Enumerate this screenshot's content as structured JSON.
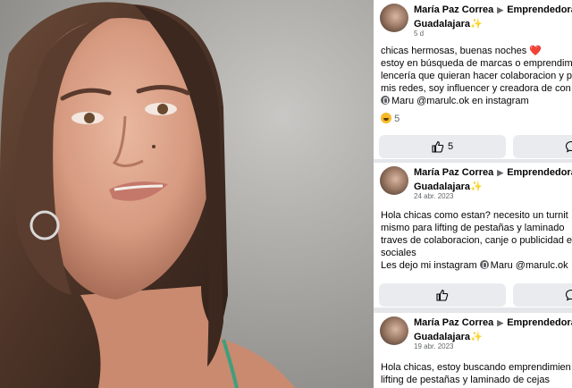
{
  "posts": [
    {
      "author": "María Paz Correa",
      "group_part1": "Emprendedora",
      "group_part2": "Guadalajara",
      "sparkle": "✨",
      "time": "5 d",
      "body": [
        "chicas hermosas, buenas noches",
        "estoy en búsqueda de marcas o emprendim",
        "lencería que quieran hacer colaboracion y p",
        "mis redes, soy influencer y creadora de con"
      ],
      "heart": "❤️",
      "mention_name": "Maru",
      "mention_rest": "@marulc.ok en instagram",
      "reaction_count": "5",
      "like_count": "5"
    },
    {
      "author": "María Paz Correa",
      "group_part1": "Emprendedora",
      "group_part2": "Guadalajara",
      "sparkle": "✨",
      "time": "24 abr. 2023",
      "body": [
        "Hola chicas como estan? necesito un turnit",
        "mismo para lifting de pestañas y laminado",
        "traves de colaboracion, canje o publicidad e",
        "sociales"
      ],
      "mention_prefix": "Les dejo mi instagram",
      "mention_name": "Maru",
      "mention_rest": "@marulc.ok"
    },
    {
      "author": "María Paz Correa",
      "group_part1": "Emprendedora",
      "group_part2": "Guadalajara",
      "sparkle": "✨",
      "time": "19 abr. 2023",
      "body": [
        "Hola chicas, estoy buscando emprendimien",
        "lifting de pestañas y laminado de cejas"
      ]
    }
  ],
  "icons": {
    "post_arrow": "play-right-icon",
    "like": "thumbs-up-icon",
    "comment": "comment-bubble-icon",
    "mention": "instagram-mention-icon",
    "reaction": "haha-emoji-icon"
  },
  "colors": {
    "feed_background": "#e4e6ea",
    "button_background": "#e9ebee",
    "meta_text": "#65676b",
    "heart": "#e41e3f"
  }
}
